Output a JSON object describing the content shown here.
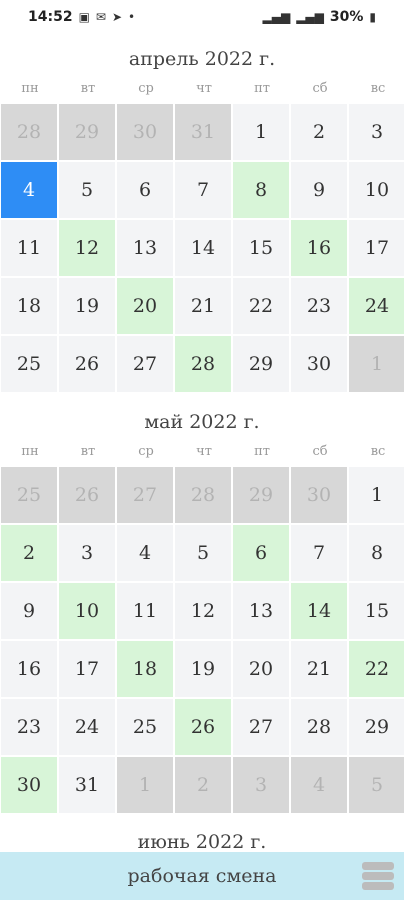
{
  "status_bar": {
    "time": "14:52",
    "battery": "30%"
  },
  "weekdays": [
    "пн",
    "вт",
    "ср",
    "чт",
    "пт",
    "сб",
    "вс"
  ],
  "months": [
    {
      "title": "апрель 2022 г.",
      "rows": [
        [
          {
            "d": "28",
            "s": "gray"
          },
          {
            "d": "29",
            "s": "gray"
          },
          {
            "d": "30",
            "s": "gray"
          },
          {
            "d": "31",
            "s": "gray"
          },
          {
            "d": "1",
            "s": ""
          },
          {
            "d": "2",
            "s": ""
          },
          {
            "d": "3",
            "s": ""
          }
        ],
        [
          {
            "d": "4",
            "s": "sel"
          },
          {
            "d": "5",
            "s": ""
          },
          {
            "d": "6",
            "s": ""
          },
          {
            "d": "7",
            "s": ""
          },
          {
            "d": "8",
            "s": "green"
          },
          {
            "d": "9",
            "s": ""
          },
          {
            "d": "10",
            "s": ""
          }
        ],
        [
          {
            "d": "11",
            "s": ""
          },
          {
            "d": "12",
            "s": "green"
          },
          {
            "d": "13",
            "s": ""
          },
          {
            "d": "14",
            "s": ""
          },
          {
            "d": "15",
            "s": ""
          },
          {
            "d": "16",
            "s": "green"
          },
          {
            "d": "17",
            "s": ""
          }
        ],
        [
          {
            "d": "18",
            "s": ""
          },
          {
            "d": "19",
            "s": ""
          },
          {
            "d": "20",
            "s": "green"
          },
          {
            "d": "21",
            "s": ""
          },
          {
            "d": "22",
            "s": ""
          },
          {
            "d": "23",
            "s": ""
          },
          {
            "d": "24",
            "s": "green"
          }
        ],
        [
          {
            "d": "25",
            "s": ""
          },
          {
            "d": "26",
            "s": ""
          },
          {
            "d": "27",
            "s": ""
          },
          {
            "d": "28",
            "s": "green"
          },
          {
            "d": "29",
            "s": ""
          },
          {
            "d": "30",
            "s": ""
          },
          {
            "d": "1",
            "s": "gray"
          }
        ]
      ]
    },
    {
      "title": "май 2022 г.",
      "rows": [
        [
          {
            "d": "25",
            "s": "gray"
          },
          {
            "d": "26",
            "s": "gray"
          },
          {
            "d": "27",
            "s": "gray"
          },
          {
            "d": "28",
            "s": "gray"
          },
          {
            "d": "29",
            "s": "gray"
          },
          {
            "d": "30",
            "s": "gray"
          },
          {
            "d": "1",
            "s": ""
          }
        ],
        [
          {
            "d": "2",
            "s": "green"
          },
          {
            "d": "3",
            "s": ""
          },
          {
            "d": "4",
            "s": ""
          },
          {
            "d": "5",
            "s": ""
          },
          {
            "d": "6",
            "s": "green"
          },
          {
            "d": "7",
            "s": ""
          },
          {
            "d": "8",
            "s": ""
          }
        ],
        [
          {
            "d": "9",
            "s": ""
          },
          {
            "d": "10",
            "s": "green"
          },
          {
            "d": "11",
            "s": ""
          },
          {
            "d": "12",
            "s": ""
          },
          {
            "d": "13",
            "s": ""
          },
          {
            "d": "14",
            "s": "green"
          },
          {
            "d": "15",
            "s": ""
          }
        ],
        [
          {
            "d": "16",
            "s": ""
          },
          {
            "d": "17",
            "s": ""
          },
          {
            "d": "18",
            "s": "green"
          },
          {
            "d": "19",
            "s": ""
          },
          {
            "d": "20",
            "s": ""
          },
          {
            "d": "21",
            "s": ""
          },
          {
            "d": "22",
            "s": "green"
          }
        ],
        [
          {
            "d": "23",
            "s": ""
          },
          {
            "d": "24",
            "s": ""
          },
          {
            "d": "25",
            "s": ""
          },
          {
            "d": "26",
            "s": "green"
          },
          {
            "d": "27",
            "s": ""
          },
          {
            "d": "28",
            "s": ""
          },
          {
            "d": "29",
            "s": ""
          }
        ],
        [
          {
            "d": "30",
            "s": "green"
          },
          {
            "d": "31",
            "s": ""
          },
          {
            "d": "1",
            "s": "gray"
          },
          {
            "d": "2",
            "s": "gray"
          },
          {
            "d": "3",
            "s": "gray"
          },
          {
            "d": "4",
            "s": "gray"
          },
          {
            "d": "5",
            "s": "gray"
          }
        ]
      ]
    },
    {
      "title": "июнь 2022 г.",
      "rows": []
    }
  ],
  "bottom_bar": {
    "label": "рабочая смена",
    "menu_icon": "hamburger-menu-icon"
  },
  "colors": {
    "selected": "#2e8df5",
    "work_shift": "#d8f5d8",
    "other_month": "#d7d7d7",
    "bottom_bar": "#c6eaf3"
  }
}
